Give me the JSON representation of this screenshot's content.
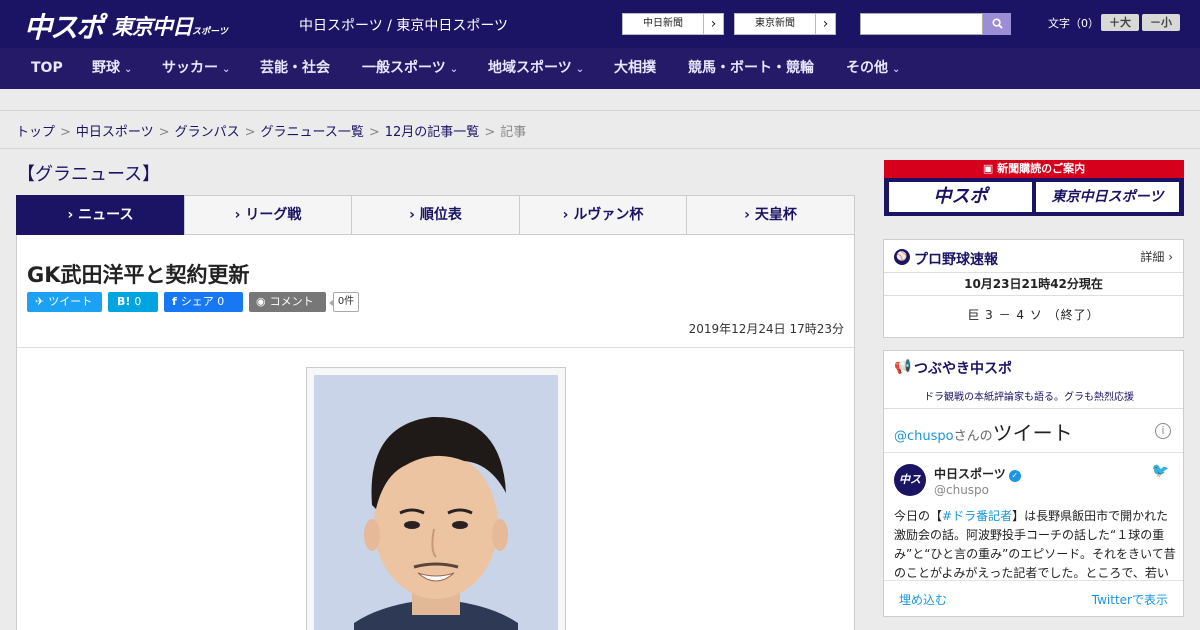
{
  "header": {
    "logo_chuspo": "中スポ",
    "logo_tokyo": "東京中日",
    "logo_tokyo_small": "スポーツ",
    "subtitle": "中日スポーツ / 東京中日スポーツ",
    "ext_links": [
      {
        "label": "中日新聞",
        "arrow": "›"
      },
      {
        "label": "東京新聞",
        "arrow": "›"
      }
    ],
    "search": {
      "value": "",
      "placeholder": "",
      "icon": "search-icon"
    },
    "font_size": {
      "label": "文字（0）",
      "larger": "＋大",
      "smaller": "－小"
    }
  },
  "nav": {
    "items": [
      {
        "label": "TOP",
        "has_dropdown": false
      },
      {
        "label": "野球",
        "has_dropdown": true
      },
      {
        "label": "サッカー",
        "has_dropdown": true
      },
      {
        "label": "芸能・社会",
        "has_dropdown": false
      },
      {
        "label": "一般スポーツ",
        "has_dropdown": true
      },
      {
        "label": "地域スポーツ",
        "has_dropdown": true
      },
      {
        "label": "大相撲",
        "has_dropdown": false
      },
      {
        "label": "競馬・ボート・競輪",
        "has_dropdown": false
      },
      {
        "label": "その他",
        "has_dropdown": true
      }
    ],
    "chevron": "⌄"
  },
  "breadcrumb": {
    "items": [
      "トップ",
      "中日スポーツ",
      "グランパス",
      "グラニュース一覧",
      "12月の記事一覧"
    ],
    "current": "記事",
    "separator": ">"
  },
  "section": {
    "title": "【グラニュース】"
  },
  "tabs": [
    {
      "label": "› ニュース",
      "active": true
    },
    {
      "label": "› リーグ戦",
      "active": false
    },
    {
      "label": "› 順位表",
      "active": false
    },
    {
      "label": "› ルヴァン杯",
      "active": false
    },
    {
      "label": "› 天皇杯",
      "active": false
    }
  ],
  "article": {
    "title": "GK武田洋平と契約更新",
    "date": "2019年12月24日 17時23分",
    "share": {
      "tweet": {
        "icon": "twitter-bird-icon",
        "label": "ツイート",
        "color": "#1da1f2"
      },
      "hatena": {
        "icon": "B!",
        "label": "0",
        "color": "#00a4de"
      },
      "facebook": {
        "icon": "facebook-icon",
        "label": "シェア 0",
        "color": "#1877f2"
      },
      "comment": {
        "icon": "speech-bubble-icon",
        "label": "コメント",
        "color": "#777777"
      },
      "comment_count": "0件"
    }
  },
  "sidebar": {
    "promo": {
      "heading": "新聞購読のご案内",
      "boxes": [
        "中スポ",
        "東京中日スポーツ"
      ]
    },
    "baseball": {
      "icon": "baseball-icon",
      "title": "プロ野球速報",
      "detail": "詳細 ›",
      "timestamp": "10月23日21時42分現在",
      "score": "巨 3 － 4 ソ （終了）"
    },
    "tweets": {
      "title": "つぶやき中スポ",
      "subtitle": "ドラ観戦の本紙評論家も語る。グラも熱烈応援",
      "icon": "megaphone-icon",
      "heading_handle": "@chuspo",
      "heading_san": "さんの",
      "heading_word": "ツイート",
      "info": "i",
      "user_name": "中日スポーツ",
      "user_handle": "@chuspo",
      "avatar_text": "中スポ",
      "body_before": "今日の【",
      "body_hashtag": "#ドラ番記者",
      "body_after": "】は長野県飯田市で開かれた激励会の話。阿波野投手コーチの話した“１球の重み”と“ひと言の重み”のエピソード。それをきいて昔のことがよみがえった記者でした。ところで、若い",
      "embed": "埋め込む",
      "view_on_twitter": "Twitterで表示"
    }
  },
  "colors": {
    "brand_navy": "#1b1464",
    "nav_bg": "#251a68",
    "promo_red": "#d6001c",
    "twitter_blue": "#1b95e0"
  }
}
